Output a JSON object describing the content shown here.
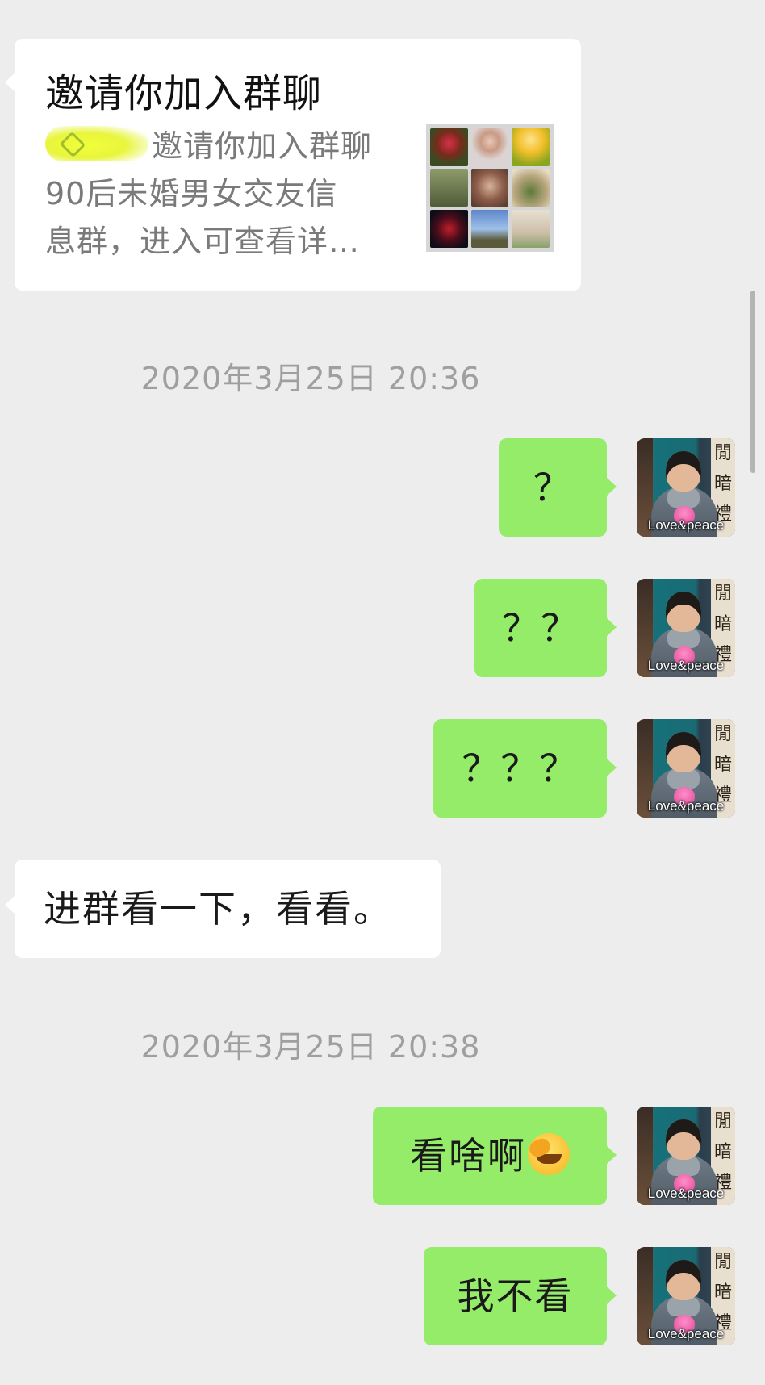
{
  "invite_card": {
    "title": "邀请你加入群聊",
    "line1_suffix": "邀请你加入群聊",
    "line2": "90后未婚男女交友信",
    "line3": "息群，进入可查看详…"
  },
  "messages": [
    {
      "timestamp": "2020年3月25日 20:36"
    },
    {
      "text": "？"
    },
    {
      "text": "？？"
    },
    {
      "text": "？？？"
    },
    {
      "text": "进群看一下，看看。"
    },
    {
      "timestamp": "2020年3月25日 20:38"
    },
    {
      "text": "看啥啊"
    },
    {
      "text": "我不看"
    }
  ],
  "avatar": {
    "caption": "Love&peace",
    "panel_chars": "閒 暗 禮"
  },
  "colors": {
    "background": "#ededed",
    "outgoing_bubble": "#95ec69",
    "incoming_bubble": "#ffffff",
    "timestamp_text": "#9f9f9f"
  },
  "icons": {
    "collage": "group-avatar-collage-icon",
    "emoji": "facepalm-emoji-icon"
  }
}
